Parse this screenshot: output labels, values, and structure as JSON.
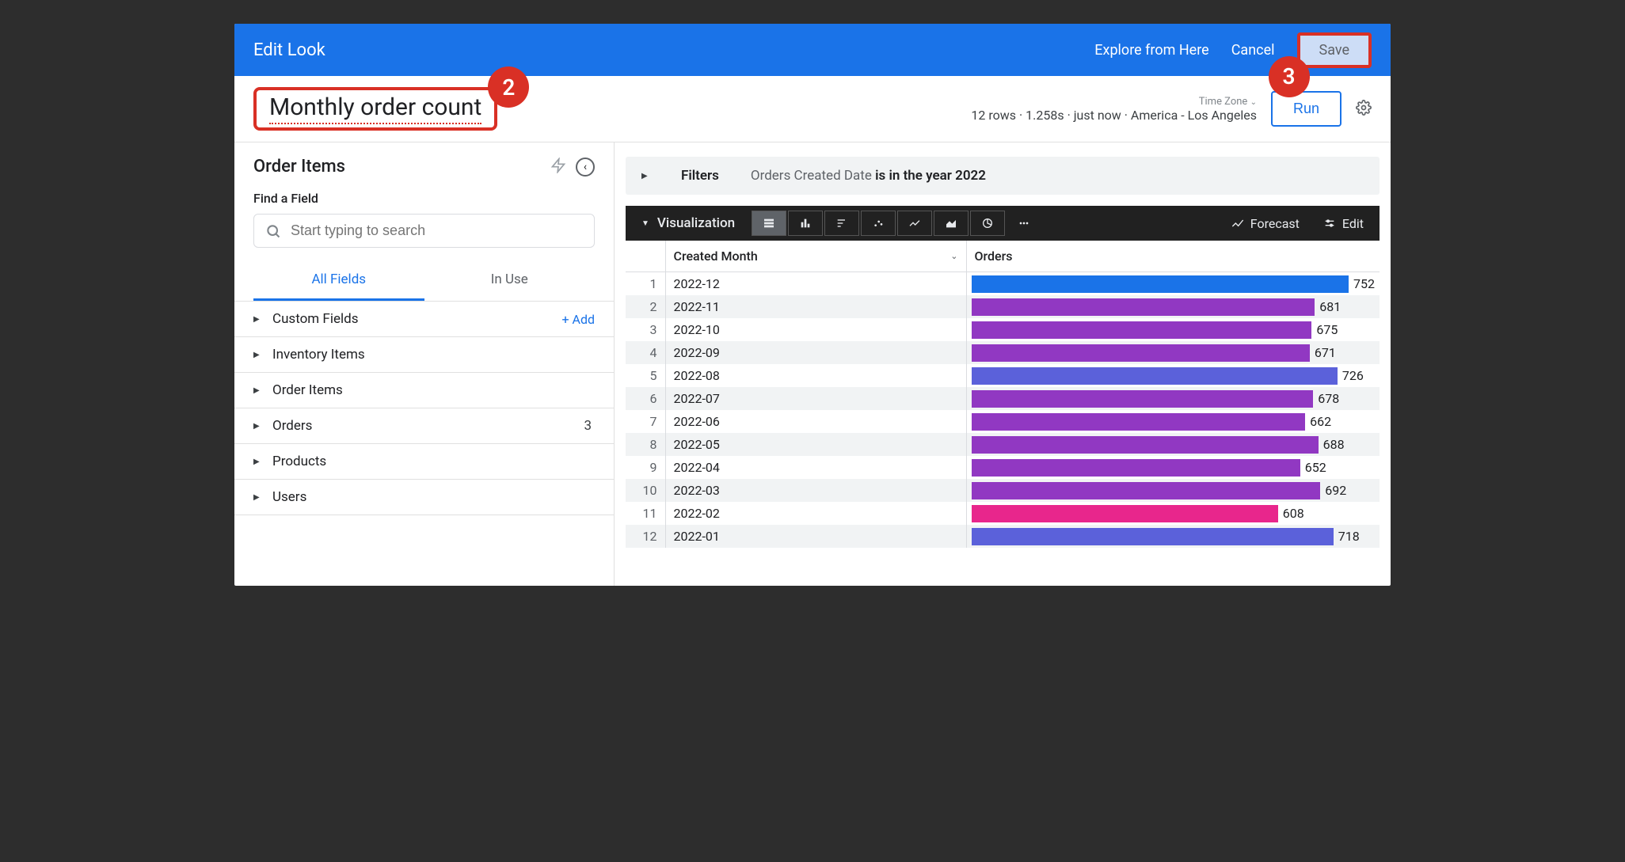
{
  "header": {
    "title": "Edit Look",
    "explore_label": "Explore from Here",
    "cancel_label": "Cancel",
    "save_label": "Save"
  },
  "annotations": {
    "badge_title": "2",
    "badge_save": "3"
  },
  "look": {
    "title": "Monthly order count"
  },
  "query_status": {
    "tz_label": "Time Zone",
    "meta": "12 rows · 1.258s · just now · America - Los Angeles",
    "run_label": "Run"
  },
  "sidebar": {
    "title": "Order Items",
    "find_label": "Find a Field",
    "search_placeholder": "Start typing to search",
    "tabs": {
      "all": "All Fields",
      "in_use": "In Use"
    },
    "custom_fields": {
      "label": "Custom Fields",
      "add_label": "+  Add"
    },
    "groups": [
      {
        "label": "Inventory Items"
      },
      {
        "label": "Order Items"
      },
      {
        "label": "Orders",
        "count": 3
      },
      {
        "label": "Products"
      },
      {
        "label": "Users"
      }
    ]
  },
  "filters": {
    "label": "Filters",
    "text_prefix": "Orders Created Date ",
    "text_bold": "is in the year 2022"
  },
  "viz": {
    "label": "Visualization",
    "icons": [
      "table",
      "column",
      "bar-h",
      "scatter",
      "line",
      "area",
      "pie",
      "more"
    ],
    "forecast_label": "Forecast",
    "edit_label": "Edit"
  },
  "table": {
    "headers": {
      "month": "Created Month",
      "orders": "Orders"
    }
  },
  "chart_data": {
    "type": "bar",
    "categories": [
      "2022-12",
      "2022-11",
      "2022-10",
      "2022-09",
      "2022-08",
      "2022-07",
      "2022-06",
      "2022-05",
      "2022-04",
      "2022-03",
      "2022-02",
      "2022-01"
    ],
    "values": [
      752,
      681,
      675,
      671,
      726,
      678,
      662,
      688,
      652,
      692,
      608,
      718
    ],
    "colors": [
      "#1a73e8",
      "#9138c2",
      "#9138c2",
      "#9138c2",
      "#5b61da",
      "#9138c2",
      "#9138c2",
      "#9138c2",
      "#9138c2",
      "#9138c2",
      "#e8268c",
      "#5b61da"
    ],
    "title": "Monthly order count",
    "xlabel": "Orders",
    "ylabel": "Created Month",
    "ylim": [
      0,
      800
    ]
  }
}
